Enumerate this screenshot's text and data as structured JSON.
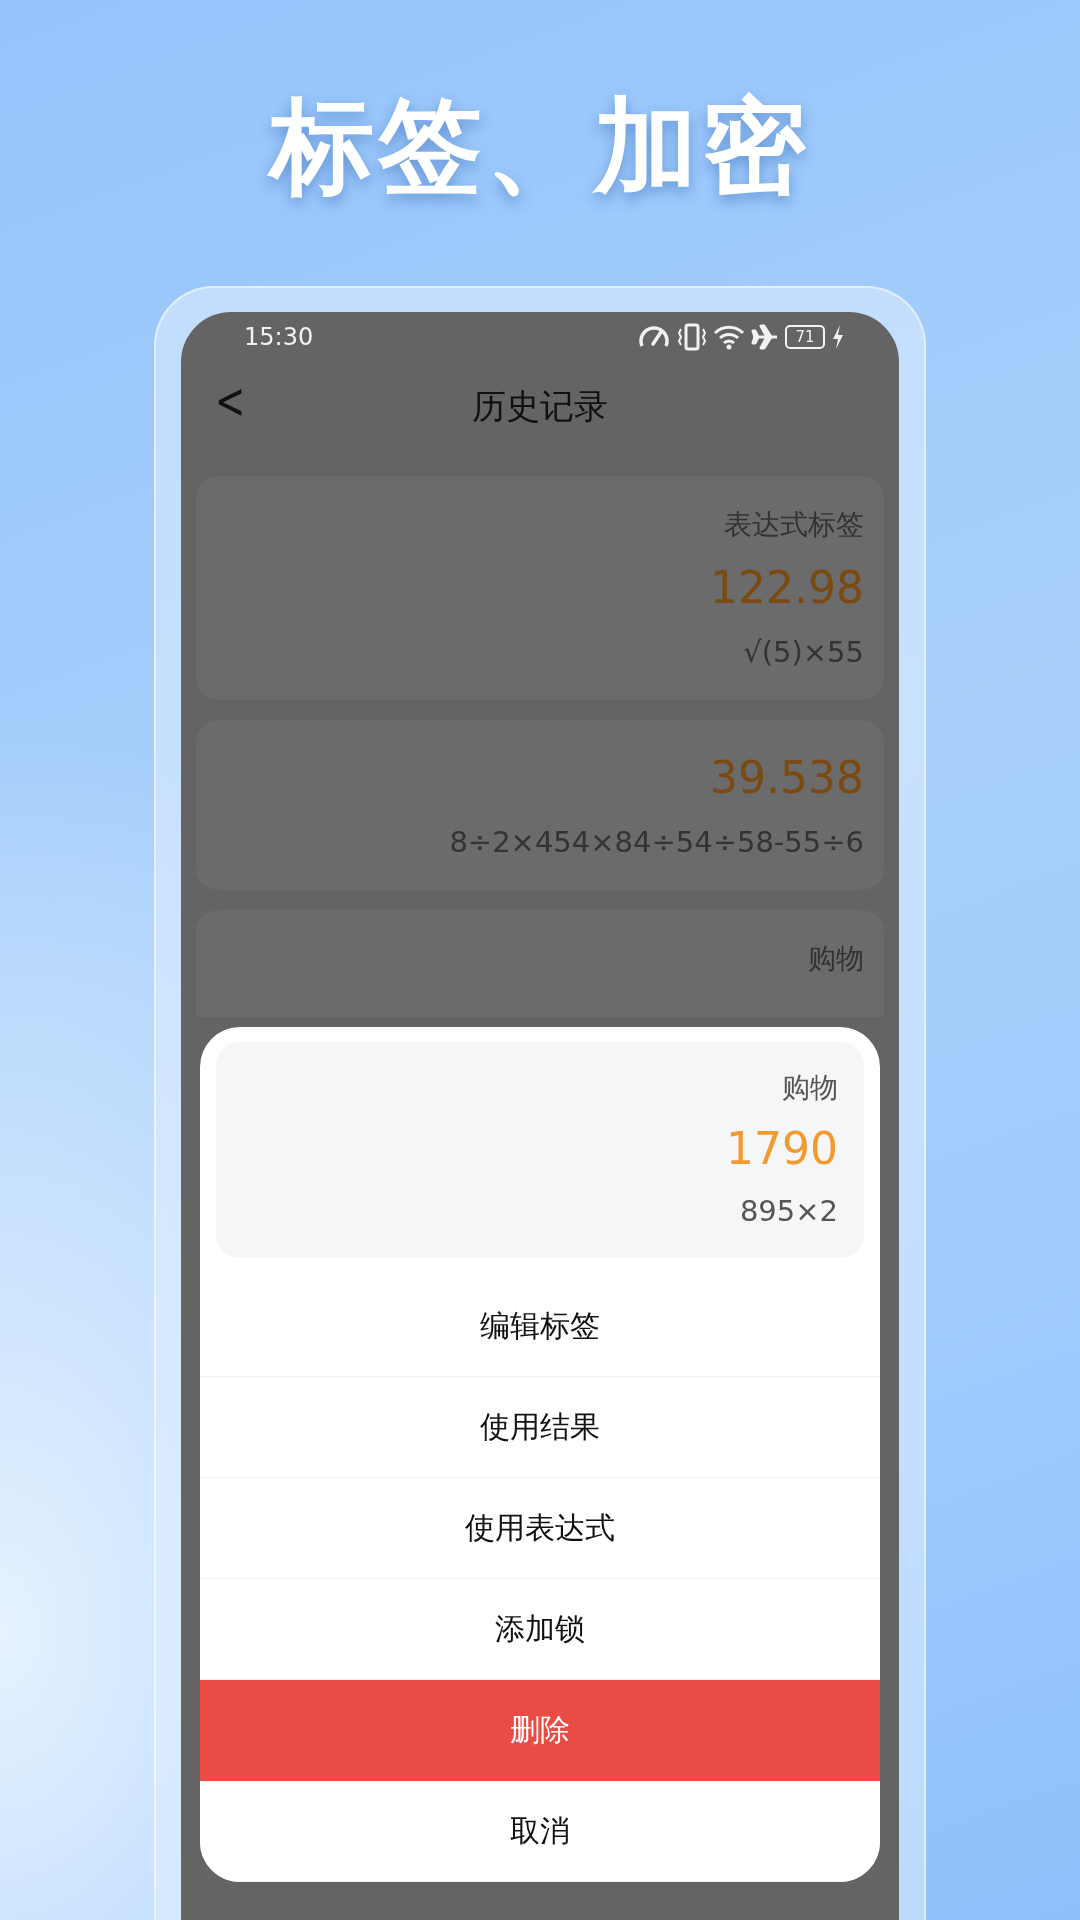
{
  "headline": "标签、加密",
  "status_bar": {
    "time": "15:30",
    "battery": "71"
  },
  "header": {
    "back": "<",
    "title": "历史记录"
  },
  "history": [
    {
      "label": "表达式标签",
      "result": "122.98",
      "expression": "√(5)×55"
    },
    {
      "result": "39.538",
      "expression": "8÷2×454×84÷54÷58-55÷6"
    },
    {
      "label": "购物"
    }
  ],
  "sheet": {
    "preview": {
      "label": "购物",
      "result": "1790",
      "expression": "895×2"
    },
    "actions": [
      {
        "label": "编辑标签",
        "kind": "normal"
      },
      {
        "label": "使用结果",
        "kind": "normal"
      },
      {
        "label": "使用表达式",
        "kind": "normal"
      },
      {
        "label": "添加锁",
        "kind": "normal"
      },
      {
        "label": "删除",
        "kind": "danger"
      },
      {
        "label": "取消",
        "kind": "normal"
      }
    ]
  }
}
